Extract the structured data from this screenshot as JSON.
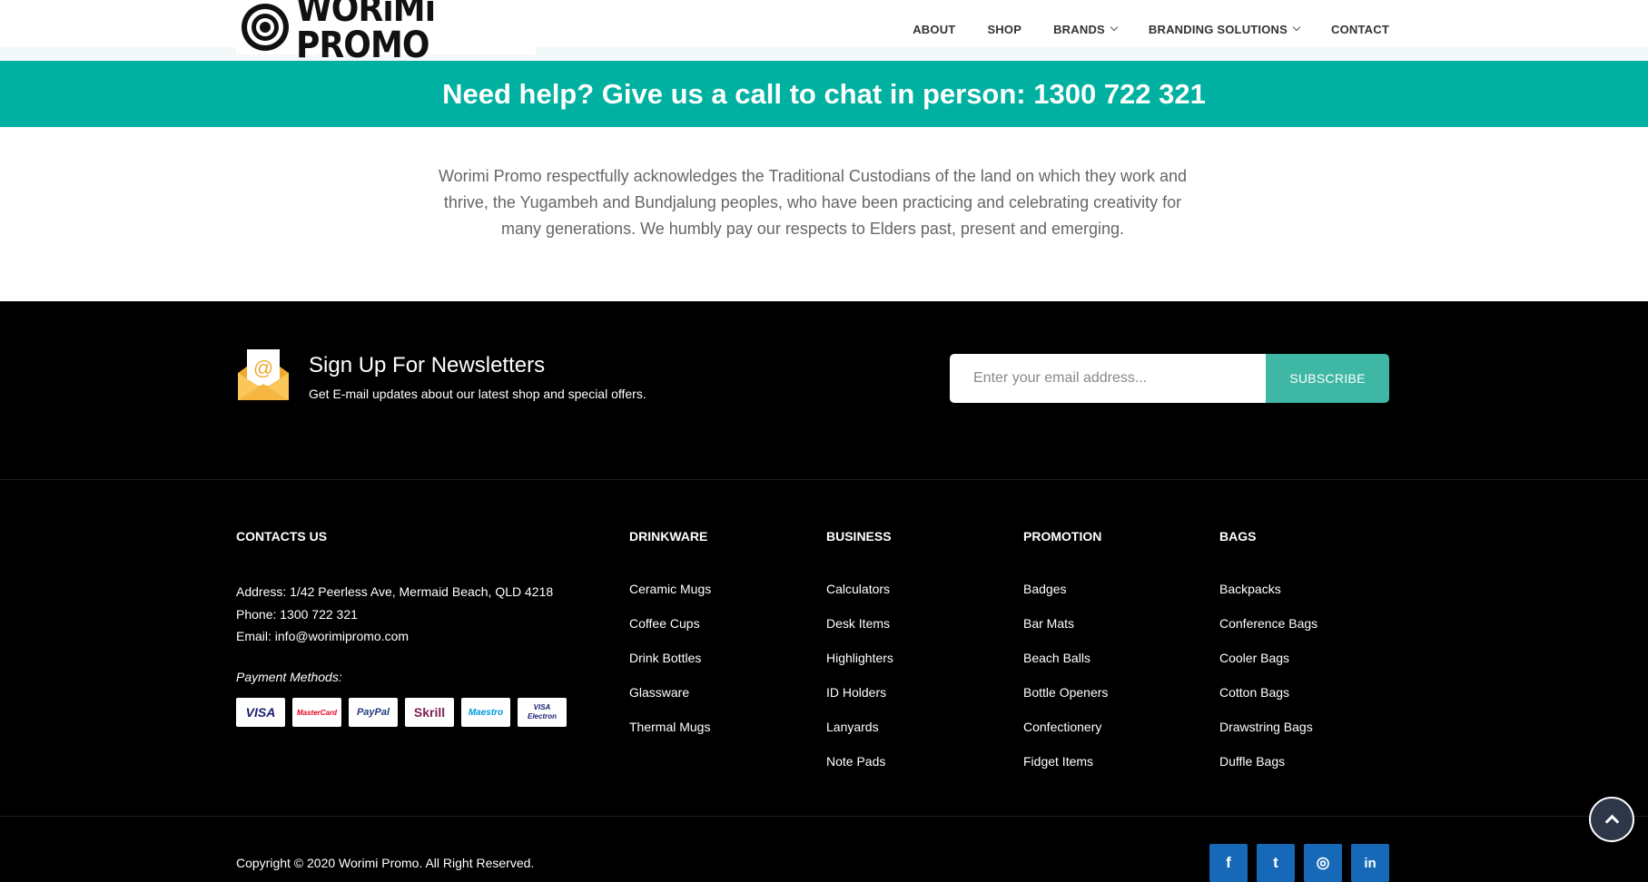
{
  "header": {
    "brand": "WORiMi PROMO",
    "nav": [
      "ABOUT",
      "SHOP",
      "BRANDS",
      "BRANDING SOLUTIONS",
      "CONTACT"
    ]
  },
  "help_band": {
    "text": "Need help? Give us a call to chat in person: 1300 722 321",
    "bg_color": "#00b0a0"
  },
  "acknowledgement": "Worimi Promo respectfully acknowledges the Traditional Custodians of the land on which they work and thrive, the Yugambeh and Bundjalung peoples, who have been practicing and celebrating creativity for many generations. We humbly pay our respects to Elders past, present and emerging.",
  "newsletter": {
    "title": "Sign Up For Newsletters",
    "subtitle": "Get E-mail updates about our latest shop and special offers.",
    "placeholder": "Enter your email address...",
    "button": "SUBSCRIBE",
    "accent": "#3fb7a5",
    "icon": "envelope-icon"
  },
  "contacts": {
    "heading": "CONTACTS US",
    "address": "Address: 1/42 Peerless Ave, Mermaid Beach, QLD 4218",
    "phone": "Phone: 1300 722 321",
    "email": "Email: info@worimipromo.com",
    "payment_label": "Payment Methods:",
    "payment_methods": [
      "VISA",
      "MasterCard",
      "PayPal",
      "Skrill",
      "Maestro",
      "VISA Electron"
    ]
  },
  "columns": [
    {
      "heading": "DRINKWARE",
      "items": [
        "Ceramic Mugs",
        "Coffee Cups",
        "Drink Bottles",
        "Glassware",
        "Thermal Mugs"
      ]
    },
    {
      "heading": "BUSINESS",
      "items": [
        "Calculators",
        "Desk Items",
        "Highlighters",
        "ID Holders",
        "Lanyards",
        "Note Pads"
      ]
    },
    {
      "heading": "PROMOTION",
      "items": [
        "Badges",
        "Bar Mats",
        "Beach Balls",
        "Bottle Openers",
        "Confectionery",
        "Fidget Items"
      ]
    },
    {
      "heading": "BAGS",
      "items": [
        "Backpacks",
        "Conference Bags",
        "Cooler Bags",
        "Cotton Bags",
        "Drawstring Bags",
        "Duffle Bags"
      ]
    }
  ],
  "footer": {
    "copyright": "Copyright © 2020 Worimi Promo. All Right Reserved.",
    "social": [
      {
        "icon": "facebook-icon",
        "glyph": "f"
      },
      {
        "icon": "twitter-icon",
        "glyph": "t"
      },
      {
        "icon": "instagram-icon",
        "glyph": "◎"
      },
      {
        "icon": "linkedin-icon",
        "glyph": "in"
      }
    ],
    "social_color": "#1769b8"
  }
}
